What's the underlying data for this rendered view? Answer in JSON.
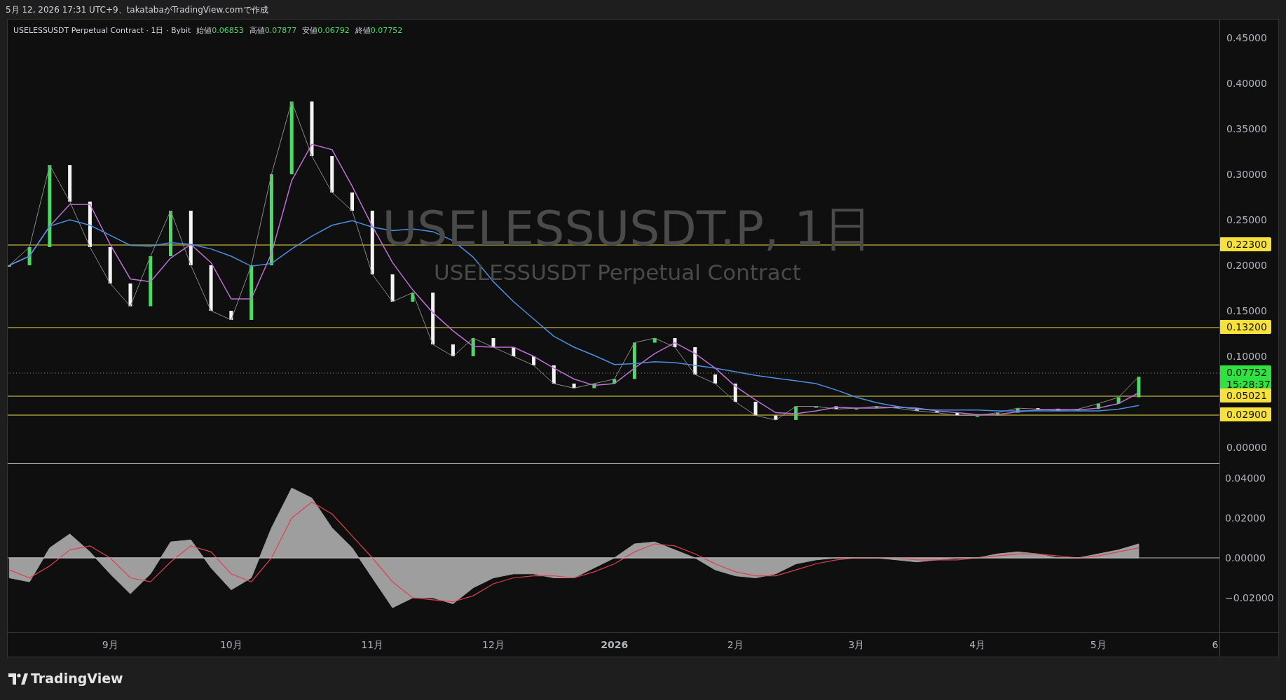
{
  "header": {
    "caption": "5月 12, 2026 17:31 UTC+9、takatabaがTradingView.comで作成"
  },
  "legend": {
    "symbol": "USELESSUSDT Perpetual Contract · 1日 · Bybit",
    "values": [
      {
        "label": "始値",
        "value": "0.06853"
      },
      {
        "label": "高値",
        "value": "0.07877"
      },
      {
        "label": "安値",
        "value": "0.06792"
      },
      {
        "label": "終値",
        "value": "0.07752"
      }
    ]
  },
  "watermark": {
    "title": "USELESSUSDT.P, 1日",
    "subtitle": "USELESSUSDT Perpetual Contract"
  },
  "price_chart": {
    "countdown": "15:28:37",
    "chart_data": {
      "type": "line",
      "series": [
        {
          "color": "#8a8a8a",
          "values": [
            0.2,
            0.22,
            0.31,
            0.27,
            0.22,
            0.18,
            0.155,
            0.21,
            0.26,
            0.2,
            0.15,
            0.14,
            0.2,
            0.3,
            0.38,
            0.32,
            0.28,
            0.26,
            0.19,
            0.16,
            0.17,
            0.113,
            0.1,
            0.12,
            0.11,
            0.1,
            0.09,
            0.07,
            0.065,
            0.07,
            0.075,
            0.115,
            0.12,
            0.11,
            0.08,
            0.07,
            0.05,
            0.035,
            0.03,
            0.045,
            0.045,
            0.042,
            0.043,
            0.045,
            0.043,
            0.04,
            0.038,
            0.035,
            0.035,
            0.038,
            0.043,
            0.042,
            0.04,
            0.042,
            0.048,
            0.055,
            0.0775
          ]
        },
        {
          "color": "#c06fd6",
          "values": [
            0.2,
            0.21,
            0.243,
            0.267,
            0.267,
            0.223,
            0.185,
            0.182,
            0.208,
            0.223,
            0.203,
            0.163,
            0.163,
            0.213,
            0.293,
            0.333,
            0.327,
            0.287,
            0.243,
            0.203,
            0.173,
            0.148,
            0.128,
            0.111,
            0.11,
            0.11,
            0.1,
            0.087,
            0.075,
            0.068,
            0.07,
            0.087,
            0.103,
            0.115,
            0.103,
            0.087,
            0.067,
            0.052,
            0.038,
            0.037,
            0.04,
            0.044,
            0.043,
            0.043,
            0.044,
            0.043,
            0.04,
            0.038,
            0.036,
            0.036,
            0.039,
            0.041,
            0.042,
            0.041,
            0.043,
            0.048,
            0.06
          ]
        },
        {
          "color": "#4a90e2",
          "values": [
            0.2,
            0.21,
            0.243,
            0.25,
            0.244,
            0.233,
            0.222,
            0.221,
            0.225,
            0.223,
            0.218,
            0.21,
            0.199,
            0.202,
            0.218,
            0.232,
            0.244,
            0.249,
            0.242,
            0.238,
            0.24,
            0.237,
            0.227,
            0.209,
            0.182,
            0.16,
            0.141,
            0.122,
            0.11,
            0.101,
            0.091,
            0.092,
            0.094,
            0.093,
            0.09,
            0.087,
            0.083,
            0.079,
            0.076,
            0.073,
            0.07,
            0.063,
            0.055,
            0.049,
            0.045,
            0.042,
            0.041,
            0.041,
            0.041,
            0.04,
            0.04,
            0.04,
            0.04,
            0.04,
            0.04,
            0.042,
            0.046
          ]
        }
      ],
      "ylim": [
        -0.0185,
        0.47
      ],
      "yticks": [
        {
          "value": 0.45,
          "label": "0.45000"
        },
        {
          "value": 0.4,
          "label": "0.40000"
        },
        {
          "value": 0.35,
          "label": "0.35000"
        },
        {
          "value": 0.3,
          "label": "0.30000"
        },
        {
          "value": 0.25,
          "label": "0.25000"
        },
        {
          "value": 0.2,
          "label": "0.20000"
        },
        {
          "value": 0.15,
          "label": "0.15000"
        },
        {
          "value": 0.1,
          "label": "0.10000"
        },
        {
          "value": 0.0,
          "label": "0.00000"
        }
      ],
      "relative": false
    }
  },
  "price_tags": [
    {
      "kind": "level",
      "text": "0.22300"
    },
    {
      "kind": "level",
      "text": "0.13200"
    },
    {
      "kind": "current",
      "text": "0.07752"
    },
    {
      "kind": "level",
      "text": "0.05021"
    },
    {
      "kind": "level",
      "text": "0.02900"
    }
  ],
  "oscillator": {
    "chart_data": {
      "type": "area",
      "categories": [
        null,
        null,
        null,
        null,
        null,
        "9月",
        null,
        null,
        null,
        null,
        null,
        "10月",
        null,
        null,
        null,
        null,
        null,
        null,
        "11月",
        null,
        null,
        null,
        null,
        null,
        "12月",
        null,
        null,
        null,
        null,
        null,
        "2026",
        null,
        null,
        null,
        null,
        null,
        "2月",
        null,
        null,
        null,
        null,
        null,
        "3月",
        null,
        null,
        null,
        null,
        null,
        "4月",
        null,
        null,
        null,
        null,
        null,
        "5月",
        null,
        null,
        null,
        null,
        null,
        "6"
      ],
      "series": [
        {
          "color": "#9e9e9e",
          "values": [
            -0.01,
            -0.012,
            0.005,
            0.012,
            0.003,
            -0.008,
            -0.018,
            -0.008,
            0.008,
            0.009,
            -0.005,
            -0.016,
            -0.01,
            0.015,
            0.035,
            0.03,
            0.015,
            0.005,
            -0.01,
            -0.025,
            -0.02,
            -0.02,
            -0.023,
            -0.015,
            -0.01,
            -0.008,
            -0.008,
            -0.01,
            -0.01,
            -0.005,
            0.0,
            0.007,
            0.008,
            0.004,
            0.0,
            -0.006,
            -0.009,
            -0.01,
            -0.008,
            -0.003,
            -0.001,
            0.0,
            0.0,
            0.0,
            -0.001,
            -0.002,
            -0.001,
            0.0,
            0.0,
            0.002,
            0.003,
            0.002,
            0.0,
            0.0,
            0.002,
            0.004,
            0.007,
            null,
            null,
            null,
            null
          ]
        },
        {
          "type": "line",
          "color": "#e0404f",
          "values": [
            -0.006,
            -0.01,
            -0.004,
            0.004,
            0.006,
            0.0,
            -0.01,
            -0.012,
            -0.002,
            0.006,
            0.003,
            -0.008,
            -0.012,
            0.0,
            0.02,
            0.028,
            0.022,
            0.011,
            0.0,
            -0.012,
            -0.02,
            -0.021,
            -0.022,
            -0.019,
            -0.013,
            -0.01,
            -0.009,
            -0.009,
            -0.01,
            -0.007,
            -0.003,
            0.003,
            0.007,
            0.006,
            0.002,
            -0.003,
            -0.007,
            -0.009,
            -0.009,
            -0.006,
            -0.003,
            -0.001,
            0.0,
            0.0,
            0.0,
            -0.001,
            -0.001,
            -0.001,
            0.0,
            0.001,
            0.002,
            0.002,
            0.001,
            0.0,
            0.001,
            0.003,
            0.005,
            null,
            null,
            null,
            null
          ]
        }
      ],
      "ylim": [
        -0.0372,
        0.047
      ],
      "yticks": [
        {
          "value": 0.04,
          "label": "0.04000"
        },
        {
          "value": 0.02,
          "label": "0.02000"
        },
        {
          "value": 0.0,
          "label": "0.00000"
        },
        {
          "value": -0.02,
          "label": "−0.02000"
        }
      ]
    }
  },
  "footer": {
    "brand": "TradingView"
  }
}
